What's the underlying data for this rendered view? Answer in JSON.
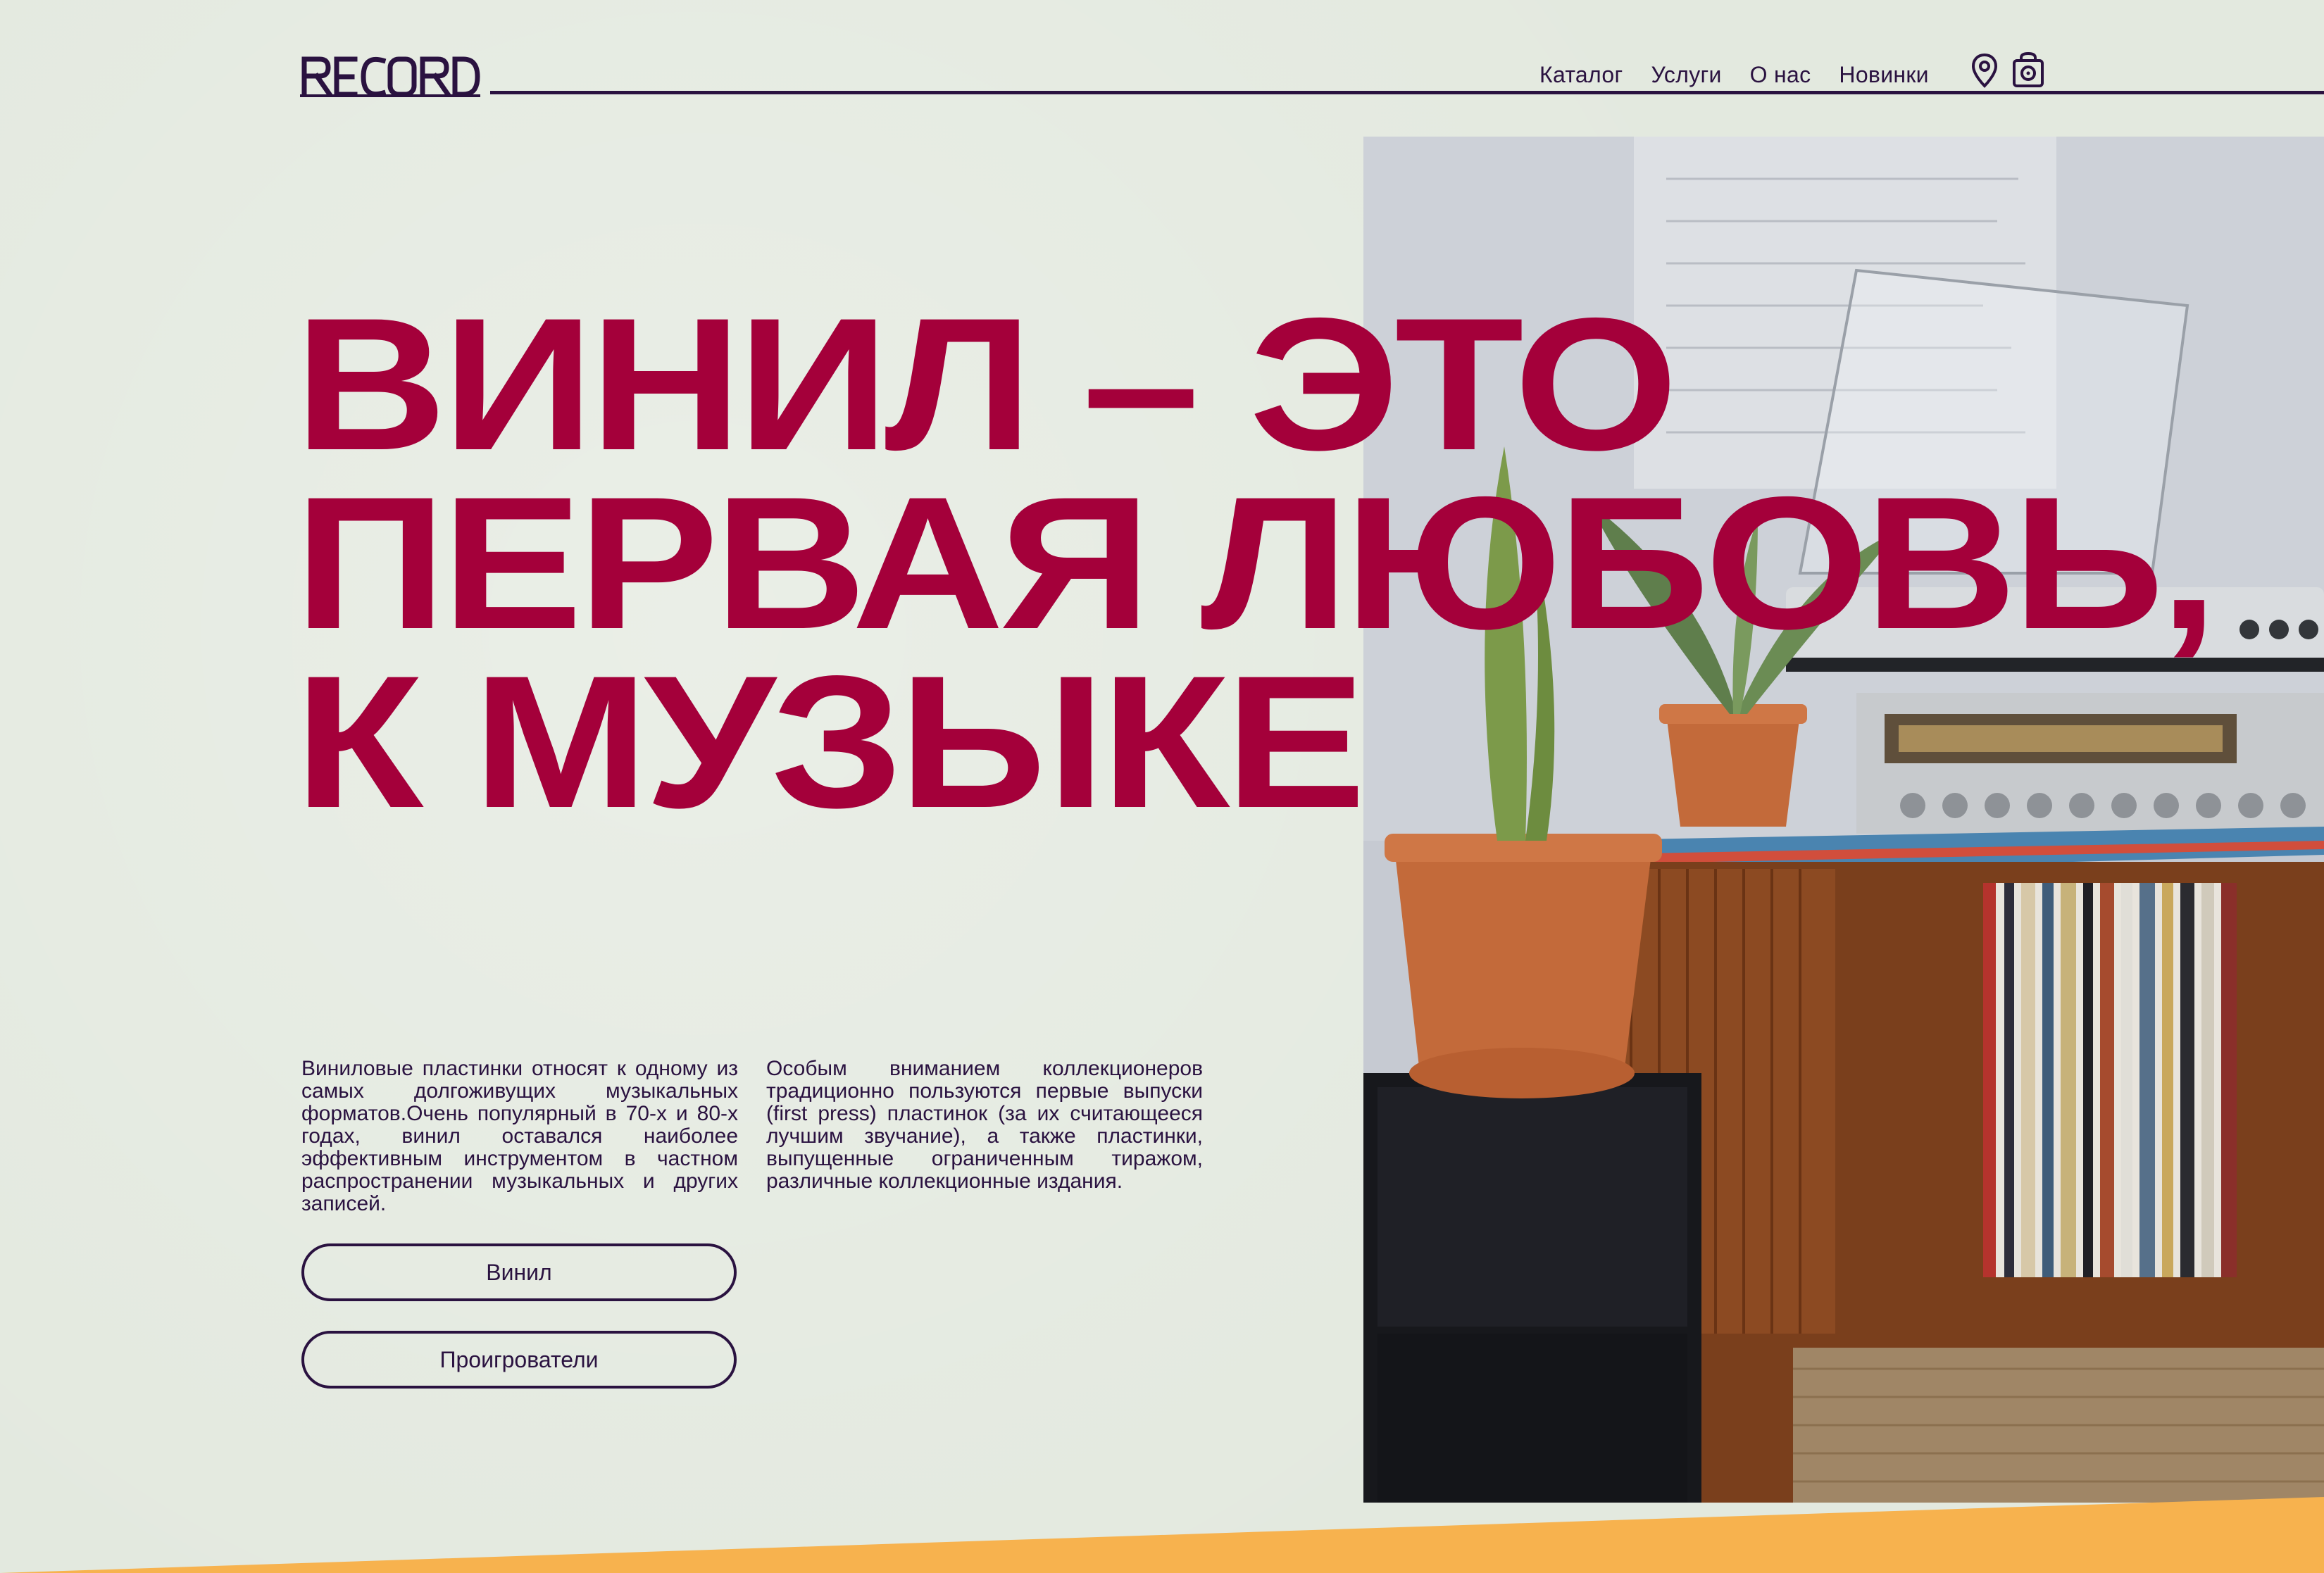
{
  "brand": {
    "logo_text": "RECORD",
    "color_primary": "#2a1240",
    "color_accent": "#a4003a",
    "color_background": "#e3e9df",
    "color_band": "#f7b24e"
  },
  "nav": {
    "items": [
      {
        "label": "Каталог"
      },
      {
        "label": "Услуги"
      },
      {
        "label": "О нас"
      },
      {
        "label": "Новинки"
      }
    ],
    "icons": [
      "location-pin-icon",
      "shop-icon"
    ]
  },
  "hero": {
    "headline_lines": [
      "ВИНИЛ – ЭТО",
      "ПЕРВАЯ ЛЮБОВЬ,",
      "К МУЗЫКЕ"
    ],
    "image_alt": "Vintage vinyl record player on wooden cabinet with plants and record collection"
  },
  "content": {
    "paragraph_1": "Виниловые пластинки относят к одному из самых долгоживущих музыкальных форматов.Очень популярный в 70-х и 80-х годах, винил оставался наиболее эффективным инструментом в частном распространении музыкальных и других записей.",
    "paragraph_2": "Особым вниманием коллекционеров традиционно пользуются первые выпуски (first press) пластинок (за их считающееся лучшим звучание), а также пластинки, выпущенные ограниченным тиражом, различные коллекционные издания."
  },
  "buttons": {
    "vinyl_label": "Винил",
    "players_label": "Проигрователи"
  }
}
